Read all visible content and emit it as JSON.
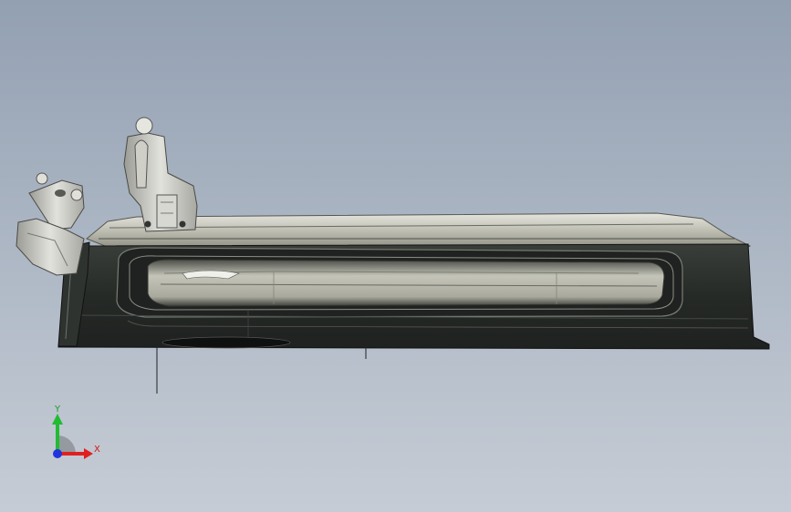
{
  "viewport": {
    "background_top": "#93a0b2",
    "background_bottom": "#c6ccd5"
  },
  "model": {
    "part_color": "#2b2f2c",
    "inner_shell_color": "#c9c9bf",
    "bracket_color": "#d5d5d0"
  },
  "triad": {
    "y_label": "Y",
    "x_label": "X",
    "y_color": "#22bb33",
    "x_color": "#e02020",
    "z_color": "#2233dd"
  }
}
